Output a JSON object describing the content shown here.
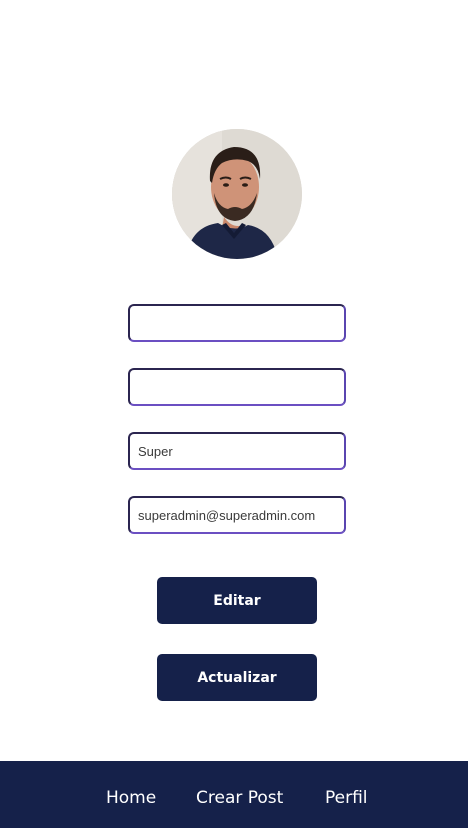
{
  "profile": {
    "avatar_alt": "Foto de perfil",
    "fields": [
      {
        "placeholder": "",
        "value": ""
      },
      {
        "placeholder": "",
        "value": ""
      },
      {
        "placeholder": "",
        "value": "Super"
      },
      {
        "placeholder": "",
        "value": "superadmin@superadmin.com"
      }
    ],
    "edit_label": "Editar",
    "update_label": "Actualizar"
  },
  "nav": {
    "items": [
      {
        "label": "Home"
      },
      {
        "label": "Crear Post"
      },
      {
        "label": "Perfil"
      }
    ]
  },
  "colors": {
    "primary": "#15214a",
    "input_border": "#2b2550",
    "input_accent": "#6b4fc2",
    "background": "#ffffff",
    "button_text": "#ffffff"
  }
}
